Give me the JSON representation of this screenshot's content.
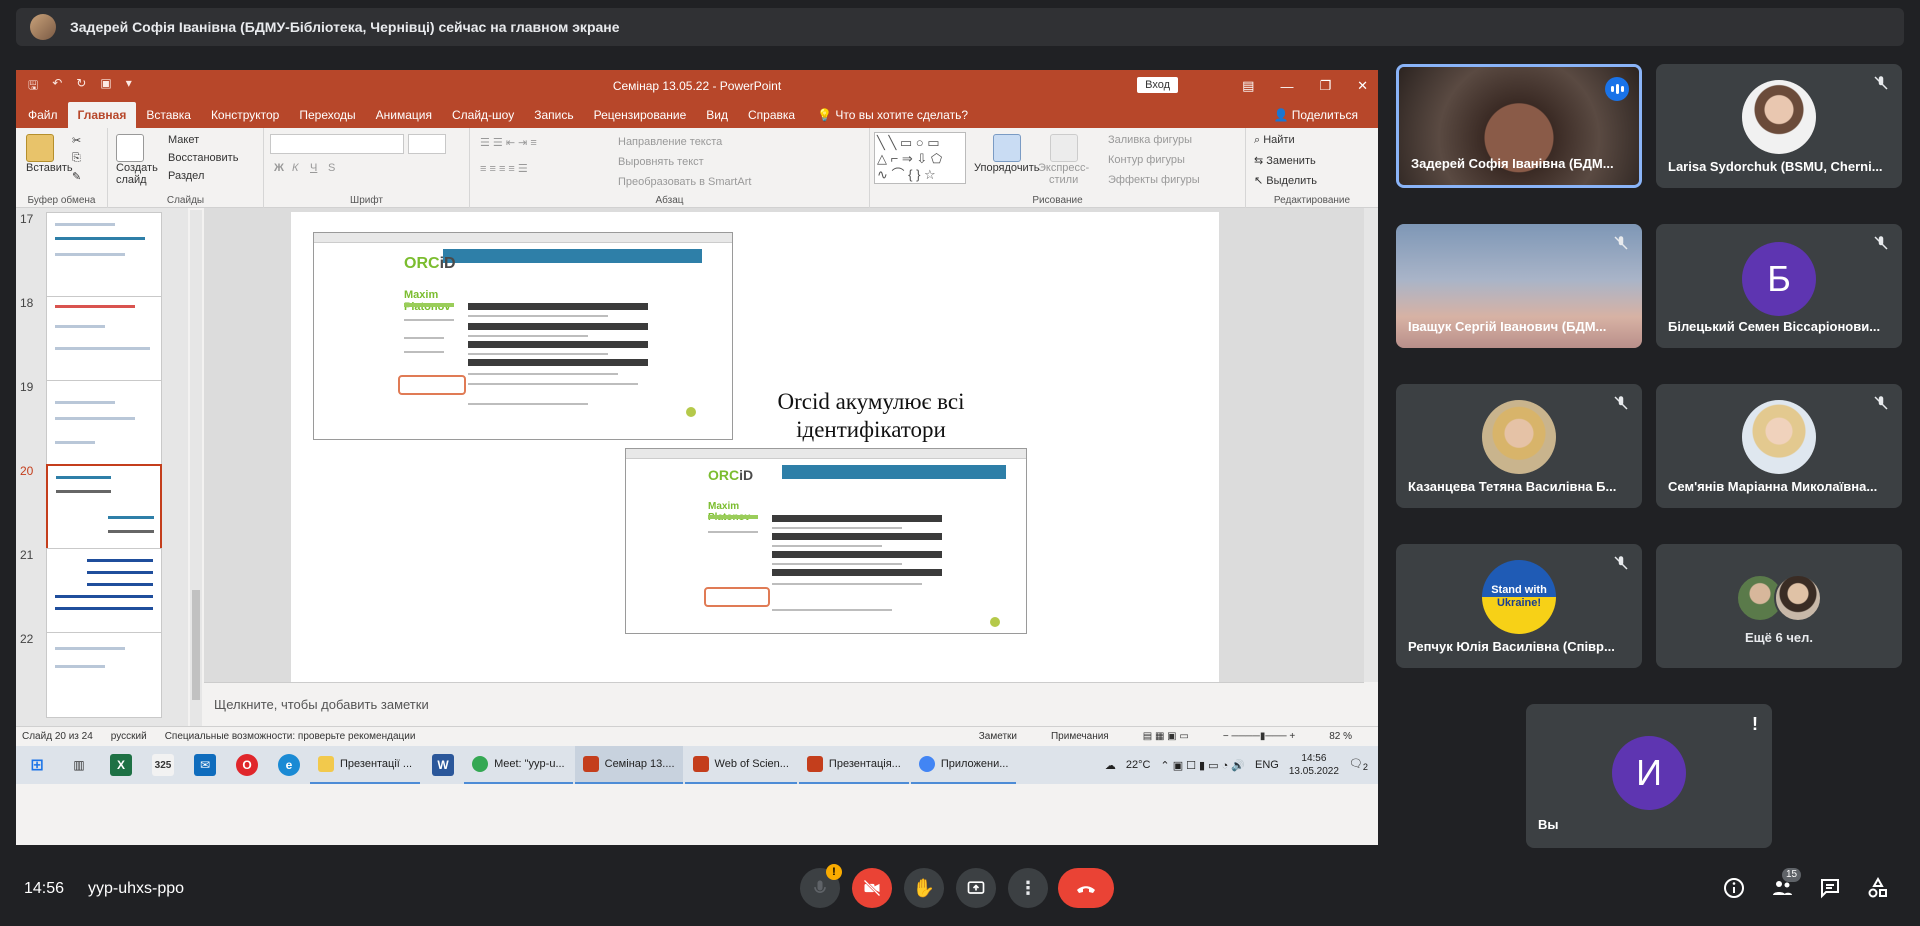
{
  "banner": {
    "text": "Задерей Софія Іванівна (БДМУ-Бібліотека, Чернівці) сейчас на главном экране"
  },
  "powerpoint": {
    "title": "Семінар 13.05.22  -  PowerPoint",
    "signin": "Вход",
    "tabs": [
      "Файл",
      "Главная",
      "Вставка",
      "Конструктор",
      "Переходы",
      "Анимация",
      "Слайд-шоу",
      "Запись",
      "Рецензирование",
      "Вид",
      "Справка"
    ],
    "active_tab": "Главная",
    "tell_me": "Что вы хотите сделать?",
    "share": "Поделиться",
    "ribbon": {
      "clipboard": {
        "paste": "Вставить",
        "label": "Буфер обмена"
      },
      "slides": {
        "new_slide_1": "Создать",
        "new_slide_2": "слайд",
        "layout": "Макет",
        "reset": "Восстановить",
        "section": "Раздел",
        "label": "Слайды"
      },
      "font": {
        "label": "Шрифт"
      },
      "paragraph": {
        "text_direction": "Направление текста",
        "align_text": "Выровнять текст",
        "smartart": "Преобразовать в SmartArt",
        "label": "Абзац"
      },
      "drawing": {
        "arrange": "Упорядочить",
        "quick_styles_1": "Экспресс-",
        "quick_styles_2": "стили",
        "fill": "Заливка фигуры",
        "outline": "Контур фигуры",
        "effects": "Эффекты фигуры",
        "label": "Рисование"
      },
      "editing": {
        "find": "Найти",
        "replace": "Заменить",
        "select": "Выделить",
        "label": "Редактирование"
      }
    },
    "thumbnails": [
      "17",
      "18",
      "19",
      "20",
      "21",
      "22"
    ],
    "selected_slide": "20",
    "slide": {
      "heading_line1": "Orcid акумулює всі",
      "heading_line2": "ідентифікатори",
      "orcid_name_1": "Maxim",
      "orcid_name_2": "Platonov"
    },
    "notes_placeholder": "Щелкните, чтобы добавить заметки",
    "status": {
      "slide_count": "Слайд 20 из 24",
      "language": "русский",
      "accessibility": "Специальные возможности: проверьте рекомендации",
      "notes": "Заметки",
      "comments": "Примечания",
      "zoom": "82 %"
    }
  },
  "taskbar": {
    "apps": [
      {
        "label": "Презентації ...",
        "color": "#f2c94c"
      },
      {
        "label": "Meet: \"yyp-u...",
        "color": "#34a853"
      },
      {
        "label": "Семінар 13....",
        "color": "#c43e1c"
      },
      {
        "label": "Web of Scien...",
        "color": "#c43e1c"
      },
      {
        "label": "Презентація...",
        "color": "#c43e1c"
      },
      {
        "label": "Приложени...",
        "color": "#4285f4"
      }
    ],
    "temperature": "22°C",
    "lang": "ENG",
    "time": "14:56",
    "date": "13.05.2022",
    "notifications": "2"
  },
  "participants": [
    {
      "name": "Задерей Софія Іванівна (БДМ...",
      "type": "video",
      "active": true
    },
    {
      "name": "Larisa Sydorchuk (BSMU, Cherni...",
      "type": "photo"
    },
    {
      "name": "Іващук Сергій Іванович (БДМ...",
      "type": "sky"
    },
    {
      "name": "Білецький Семен Віссаріонови...",
      "type": "letter",
      "letter": "Б"
    },
    {
      "name": "Казанцева Тетяна Василівна Б...",
      "type": "photo"
    },
    {
      "name": "Сем'янів Маріанна Миколаївна...",
      "type": "photo"
    },
    {
      "name": "Репчук Юлія Василівна (Співр...",
      "type": "ukraine"
    },
    {
      "name": "Ещё 6 чел.",
      "type": "more"
    },
    {
      "name": "Вы",
      "type": "letter",
      "letter": "И"
    }
  ],
  "ukraine_badge": {
    "line1": "Stand with",
    "line2": "Ukraine!"
  },
  "meet": {
    "time": "14:56",
    "code": "yyp-uhxs-ppo",
    "mic_badge": "!",
    "people_count": "15"
  },
  "icons": {
    "mic": "mic-icon",
    "camera_off": "camera-off-icon",
    "raise_hand": "hand-icon",
    "present": "present-icon",
    "more": "more-icon",
    "hangup": "hangup-icon",
    "info": "info-icon",
    "people": "people-icon",
    "chat": "chat-icon",
    "activities": "activities-icon"
  }
}
